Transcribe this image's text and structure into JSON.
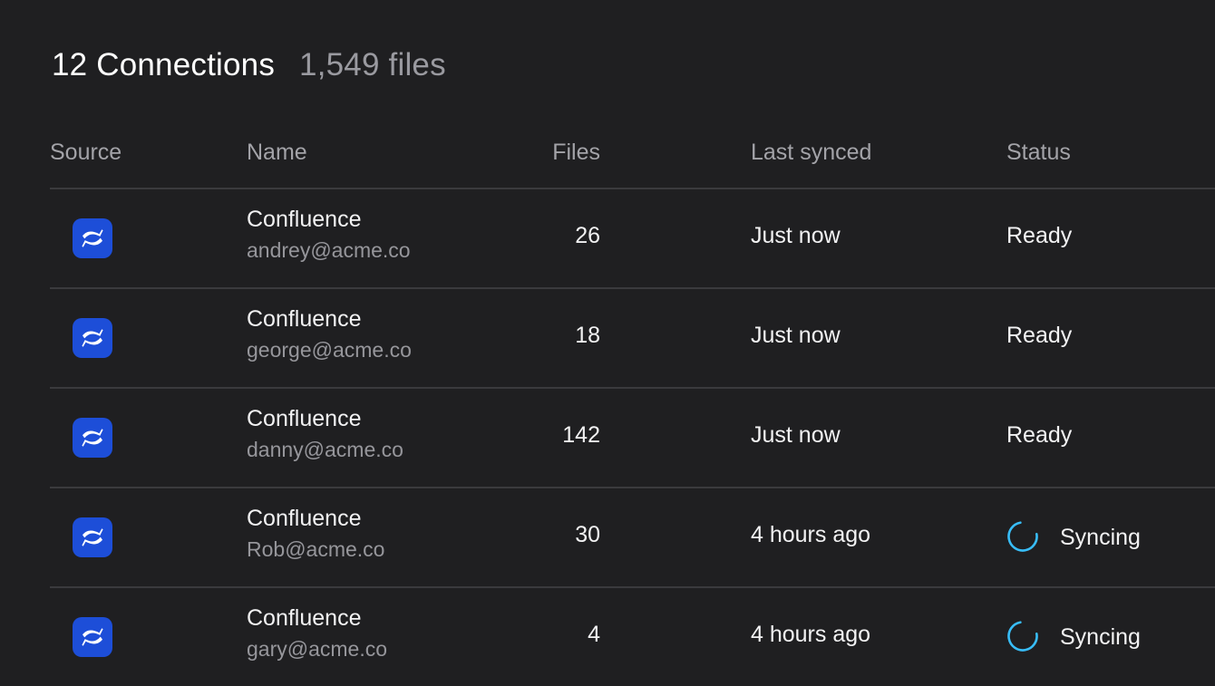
{
  "header": {
    "title": "12 Connections",
    "subtitle": "1,549 files"
  },
  "table": {
    "columns": {
      "source": "Source",
      "name": "Name",
      "files": "Files",
      "last_synced": "Last synced",
      "status": "Status"
    },
    "rows": [
      {
        "source_icon": "confluence-icon",
        "name": "Confluence",
        "email": "andrey@acme.co",
        "files": "26",
        "last_synced": "Just now",
        "status": "Ready"
      },
      {
        "source_icon": "confluence-icon",
        "name": "Confluence",
        "email": "george@acme.co",
        "files": "18",
        "last_synced": "Just now",
        "status": "Ready"
      },
      {
        "source_icon": "confluence-icon",
        "name": "Confluence",
        "email": "danny@acme.co",
        "files": "142",
        "last_synced": "Just now",
        "status": "Ready"
      },
      {
        "source_icon": "confluence-icon",
        "name": "Confluence",
        "email": "Rob@acme.co",
        "files": "30",
        "last_synced": "4 hours ago",
        "status": "Syncing"
      },
      {
        "source_icon": "confluence-icon",
        "name": "Confluence",
        "email": "gary@acme.co",
        "files": "4",
        "last_synced": "4 hours ago",
        "status": "Syncing"
      }
    ]
  },
  "colors": {
    "background": "#1f1f21",
    "divider": "#3a3a3d",
    "confluence_brand": "#1d4ed8",
    "spinner_accent": "#38bdf8"
  }
}
